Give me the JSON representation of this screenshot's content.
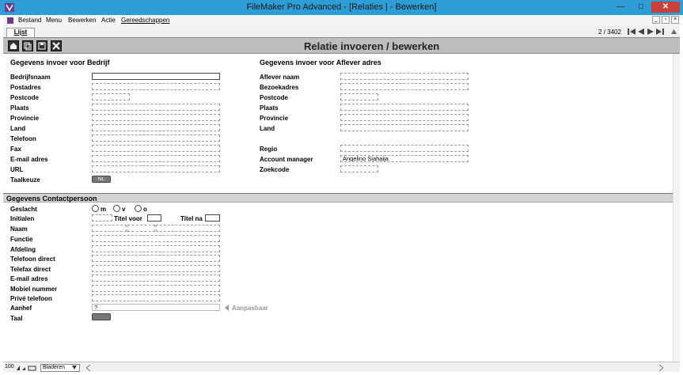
{
  "window": {
    "title": "FileMaker Pro Advanced - [Relaties | - Bewerken]",
    "close_glyph": "✕",
    "minimize_glyph": "—",
    "maximize_glyph": "□"
  },
  "menu": {
    "items": [
      "Bestand",
      "Menu",
      "Bewerken",
      "Actie",
      "Gereedschappen"
    ]
  },
  "tabs": {
    "active": "Lijst"
  },
  "record": {
    "position": "2 / 3402"
  },
  "header": {
    "title": "Relatie invoeren / bewerken"
  },
  "bedrijf": {
    "section_title": "Gegevens invoer voor Bedrijf",
    "fields": [
      {
        "label": "Bedrijfsnaam",
        "value": ""
      },
      {
        "label": "Postadres",
        "value": ""
      },
      {
        "label": "Postcode",
        "value": ""
      },
      {
        "label": "Plaats",
        "value": ""
      },
      {
        "label": "Provincie",
        "value": ""
      },
      {
        "label": "Land",
        "value": ""
      },
      {
        "label": "Telefoon",
        "value": ""
      },
      {
        "label": "Fax",
        "value": ""
      },
      {
        "label": "E-mail adres",
        "value": ""
      },
      {
        "label": "URL",
        "value": ""
      },
      {
        "label": "Taalkeuze",
        "value": "NL"
      }
    ]
  },
  "aflever": {
    "section_title": "Gegevens invoer voor Aflever adres",
    "fields": [
      {
        "label": "Aflever naam",
        "value": ""
      },
      {
        "label": "Bezoekadres",
        "value": ""
      },
      {
        "label": "Postcode",
        "value": ""
      },
      {
        "label": "Plaats",
        "value": ""
      },
      {
        "label": "Provincie",
        "value": ""
      },
      {
        "label": "Land",
        "value": ""
      },
      {
        "label": "Regio",
        "value": ""
      },
      {
        "label": "Account manager",
        "value": "Angelino Siahaija"
      },
      {
        "label": "Zoekcode",
        "value": ""
      }
    ]
  },
  "contact": {
    "section_title": "Gegevens Contactpersoon",
    "gender_options": [
      "m",
      "v",
      "o"
    ],
    "titel_voor_label": "Titel voor",
    "titel_na_label": "Titel na",
    "aanpasbaar_label": "Aanpasbaar",
    "fields": [
      {
        "label": "Geslacht",
        "value": ""
      },
      {
        "label": "Initialen",
        "value": ""
      },
      {
        "label": "Naam",
        "value": ""
      },
      {
        "label": "Functie",
        "value": ""
      },
      {
        "label": "Afdeling",
        "value": ""
      },
      {
        "label": "Telefoon direct",
        "value": ""
      },
      {
        "label": "Telefax direct",
        "value": ""
      },
      {
        "label": "E-mail adres",
        "value": ""
      },
      {
        "label": "Mobiel nummer",
        "value": ""
      },
      {
        "label": "Privé telefoon",
        "value": ""
      },
      {
        "label": "Aanhef",
        "value": "?"
      },
      {
        "label": "Taal",
        "value": ""
      }
    ]
  },
  "statusbar": {
    "zoom": "100",
    "mode": "Bladeren"
  }
}
